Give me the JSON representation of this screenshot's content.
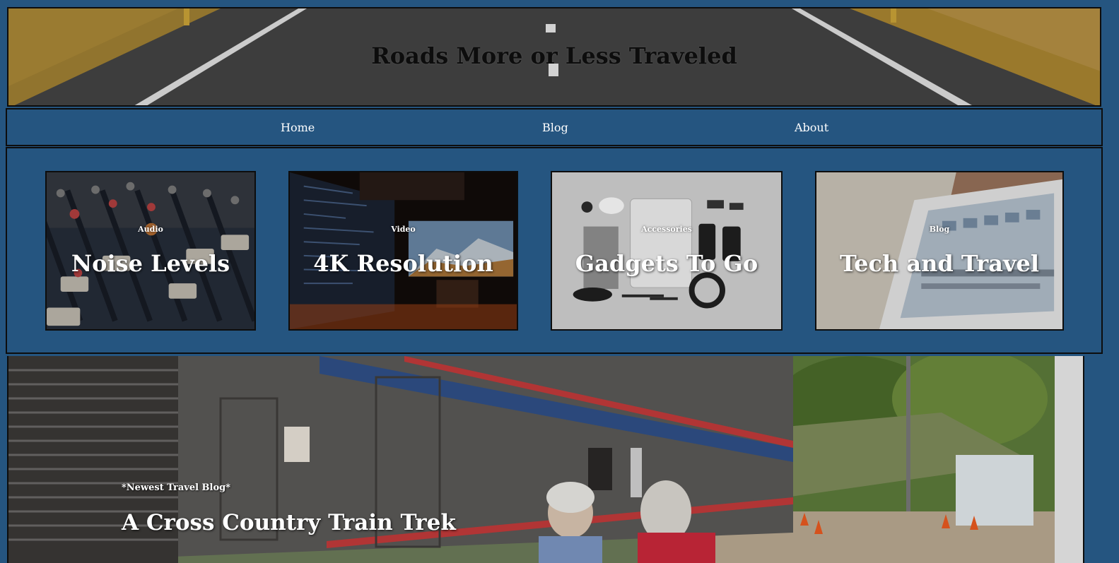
{
  "site": {
    "title": "Roads More or Less Traveled"
  },
  "nav": {
    "items": [
      {
        "label": "Home"
      },
      {
        "label": "Blog"
      },
      {
        "label": "About"
      }
    ]
  },
  "cards": [
    {
      "category": "Audio",
      "title": "Noise Levels",
      "image": "audio-mixer-photo"
    },
    {
      "category": "Video",
      "title": "4K Resolution",
      "image": "monitors-photo"
    },
    {
      "category": "Accessories",
      "title": "Gadgets To Go",
      "image": "gadgets-flatlay-photo"
    },
    {
      "category": "Blog",
      "title": "Tech and Travel",
      "image": "tablet-newspaper-photo"
    }
  ],
  "hero": {
    "label": "*Newest Travel Blog*",
    "title": "A Cross Country Train Trek",
    "image": "train-station-photo"
  },
  "colors": {
    "page_background": "#255580",
    "border": "#0d0d0d",
    "text_light": "#ffffff",
    "header_title": "#0d0d0d"
  }
}
